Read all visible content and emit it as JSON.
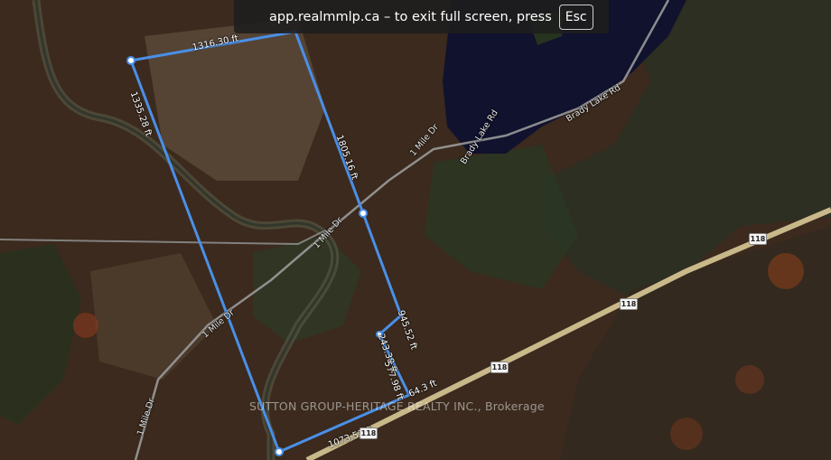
{
  "banner": {
    "message": "app.realmmlp.ca – to exit full screen, press",
    "key": "Esc"
  },
  "watermark": "SUTTON GROUP-HERITAGE REALTY INC., Brokerage",
  "measurements": [
    "1316.30 ft",
    "1335.28 ft",
    "1805.16 ft",
    "945.52 ft",
    "243.38 ft",
    "577.98 ft",
    "64.3 ft",
    "1073.51 ft"
  ],
  "roads": {
    "mile_dr": "1 Mile Dr",
    "brady_lake_rd": "Brady Lake Rd",
    "highway": "118"
  },
  "colors": {
    "boundary": "#4a8fe8",
    "banner_bg": "#1e1e1e",
    "lake": "#10122e",
    "forest": "#3b2a1d",
    "evergreen": "#23321f",
    "highway": "#c9b98a"
  }
}
